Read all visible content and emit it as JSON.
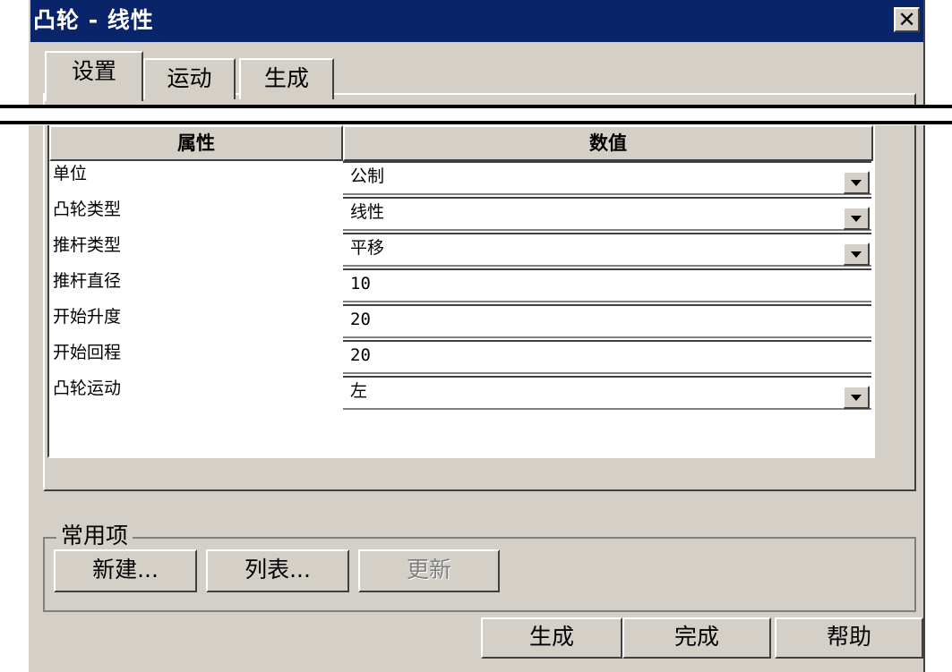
{
  "window": {
    "title": "凸轮 - 线性",
    "close_glyph": "✕"
  },
  "tabs": [
    {
      "label": "设置",
      "active": true
    },
    {
      "label": "运动",
      "active": false
    },
    {
      "label": "生成",
      "active": false
    }
  ],
  "grid": {
    "headers": [
      "属性",
      "数值"
    ],
    "rows": [
      {
        "property": "单位",
        "value": "公制",
        "dropdown": true
      },
      {
        "property": "凸轮类型",
        "value": "线性",
        "dropdown": true
      },
      {
        "property": "推杆类型",
        "value": "平移",
        "dropdown": true
      },
      {
        "property": "推杆直径",
        "value": "10",
        "dropdown": false
      },
      {
        "property": "开始升度",
        "value": "20",
        "dropdown": false
      },
      {
        "property": "开始回程",
        "value": "20",
        "dropdown": false
      },
      {
        "property": "凸轮运动",
        "value": "左",
        "dropdown": true
      }
    ]
  },
  "common": {
    "label": "常用项",
    "new_label": "新建...",
    "list_label": "列表...",
    "update_label": "更新"
  },
  "footer": {
    "generate_label": "生成",
    "done_label": "完成",
    "help_label": "帮助"
  },
  "colors": {
    "titlebar": "#0a246a",
    "face": "#d4d0c8",
    "field": "#ffffff"
  }
}
